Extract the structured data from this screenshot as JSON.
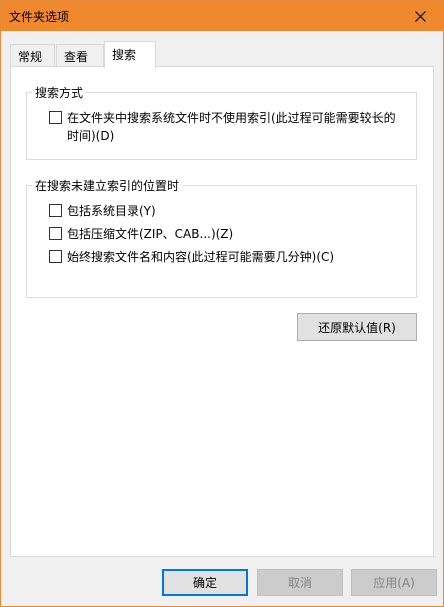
{
  "window": {
    "title": "文件夹选项"
  },
  "tabs": [
    {
      "label": "常规"
    },
    {
      "label": "查看"
    },
    {
      "label": "搜索"
    }
  ],
  "search_method": {
    "heading": "搜索方式",
    "options": [
      {
        "label_line1": "在文件夹中搜索系统文件时不使用索引(此过程可能需要较长的",
        "label_line2": "时间)(D)",
        "checked": false
      }
    ]
  },
  "non_indexed": {
    "heading": "在搜索未建立索引的位置时",
    "options": [
      {
        "label": "包括系统目录(Y)",
        "checked": false
      },
      {
        "label": "包括压缩文件(ZIP、CAB...)(Z)",
        "checked": false
      },
      {
        "label": "始终搜索文件名和内容(此过程可能需要几分钟)(C)",
        "checked": false
      }
    ]
  },
  "buttons": {
    "restore_defaults": "还原默认值(R)",
    "ok": "确定",
    "cancel": "取消",
    "apply": "应用(A)"
  },
  "colors": {
    "titlebar": "#f0882e",
    "default_button_border": "#0078d7"
  }
}
